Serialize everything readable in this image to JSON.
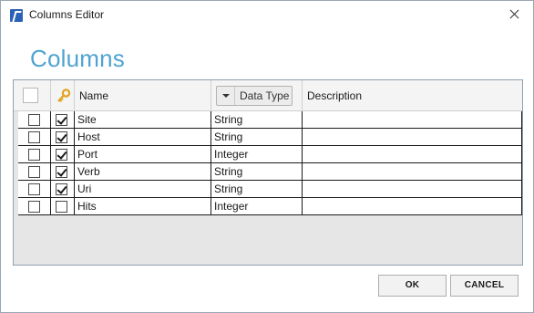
{
  "window": {
    "title": "Columns Editor"
  },
  "heading": "Columns",
  "table": {
    "columns": {
      "name": "Name",
      "data_type": "Data Type",
      "description": "Description"
    },
    "rows": [
      {
        "selected": false,
        "key": true,
        "name": "Site",
        "data_type": "String",
        "description": ""
      },
      {
        "selected": false,
        "key": true,
        "name": "Host",
        "data_type": "String",
        "description": ""
      },
      {
        "selected": false,
        "key": true,
        "name": "Port",
        "data_type": "Integer",
        "description": ""
      },
      {
        "selected": false,
        "key": true,
        "name": "Verb",
        "data_type": "String",
        "description": ""
      },
      {
        "selected": false,
        "key": true,
        "name": "Uri",
        "data_type": "String",
        "description": ""
      },
      {
        "selected": false,
        "key": false,
        "name": "Hits",
        "data_type": "Integer",
        "description": ""
      }
    ]
  },
  "buttons": {
    "ok": "OK",
    "cancel": "CANCEL"
  },
  "colors": {
    "heading": "#4fa3d1",
    "app_icon": "#2b62b8",
    "key_icon": "#e2a21b"
  }
}
